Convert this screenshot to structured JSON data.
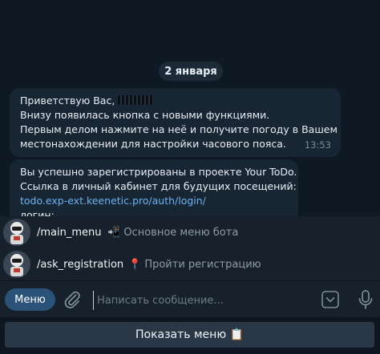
{
  "chat": {
    "date_label": "2 января",
    "messages": [
      {
        "lines": [
          "Приветствую Вас,",
          "Внизу появилась кнопка с новыми функциями.",
          "Первым делом нажмите на неё и получите погоду в Вашем",
          "местонахождении для настройки часового пояса."
        ],
        "time": "13:53"
      },
      {
        "lines": [
          "Вы успешно зарегистрированы в проекте Your ToDo.",
          "Ссылка в личный кабинет для будущих посещений:",
          "todo.exp-ext.keenetic.pro/auth/login/",
          "логин:"
        ]
      }
    ]
  },
  "commands": [
    {
      "name": "/main_menu",
      "icon": "mobile-arrow-icon",
      "emoji": "📲",
      "description": "Основное меню бота"
    },
    {
      "name": "/ask_registration",
      "icon": "pin-icon",
      "emoji": "📍",
      "description": "Пройти регистрацию"
    }
  ],
  "composer": {
    "menu_label": "Меню",
    "placeholder": "Написать сообщение..."
  },
  "keyboard": {
    "button_label": "Показать меню 📋"
  },
  "colors": {
    "background": "#0e1621",
    "bubble": "#182533",
    "link": "#6ab3f3",
    "menu_button": "#2b5278"
  }
}
